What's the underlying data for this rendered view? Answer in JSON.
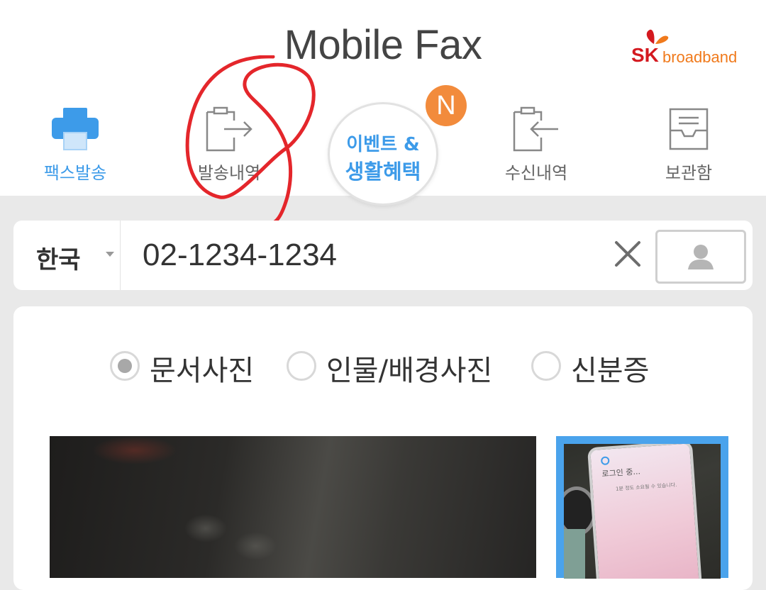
{
  "header": {
    "title": "Mobile Fax",
    "brand": {
      "sk": "SK",
      "broadband": "broadband"
    }
  },
  "nav": {
    "items": [
      {
        "label": "팩스발송",
        "icon": "printer-icon",
        "active": true
      },
      {
        "label": "발송내역",
        "icon": "send-out-icon",
        "active": false
      },
      {
        "label": "수신내역",
        "icon": "receive-in-icon",
        "active": false
      },
      {
        "label": "보관함",
        "icon": "inbox-tray-icon",
        "active": false
      }
    ],
    "event": {
      "line1": "이벤트 &",
      "line2": "생활혜택",
      "badge": "N"
    }
  },
  "phone": {
    "country": "한국",
    "number": "02-1234-1234"
  },
  "doc_type": {
    "options": [
      {
        "label": "문서사진",
        "selected": true
      },
      {
        "label": "인물/배경사진",
        "selected": false
      },
      {
        "label": "신분증",
        "selected": false
      }
    ]
  },
  "thumbnail": {
    "screen_text": "로그인 중...",
    "screen_sub": "1분 정도 소요될 수 있습니다."
  },
  "colors": {
    "accent": "#3d9be9",
    "badge": "#f28b3c",
    "sk_red": "#d4191f",
    "sk_orange": "#f07a1c"
  }
}
